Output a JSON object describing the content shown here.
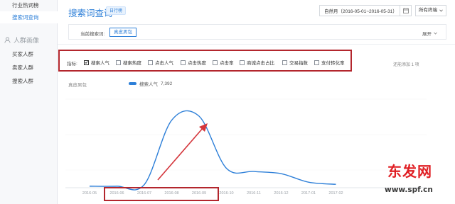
{
  "sidebar": {
    "items": [
      {
        "label": "行业热词榜",
        "active": false
      },
      {
        "label": "搜索词查询",
        "active": true
      }
    ],
    "section": {
      "label": "人群画像"
    },
    "section_items": [
      {
        "label": "买家人群"
      },
      {
        "label": "卖家人群"
      },
      {
        "label": "搜索人群"
      }
    ]
  },
  "header": {
    "title": "搜索词查询",
    "tag": "日行榜",
    "date_range": "自然月（2016-05-01~2016-05-31）",
    "terminal": "所有终端"
  },
  "search": {
    "current_label": "当前搜索词:",
    "current_term": "真皮男包",
    "collapse_label": "展开"
  },
  "metrics": {
    "label": "指标:",
    "options": [
      {
        "label": "搜索人气",
        "checked": true
      },
      {
        "label": "搜索热度",
        "checked": false
      },
      {
        "label": "点击人气",
        "checked": false
      },
      {
        "label": "点击热度",
        "checked": false
      },
      {
        "label": "点击率",
        "checked": false
      },
      {
        "label": "商城点击占比",
        "checked": false
      },
      {
        "label": "交易指数",
        "checked": false
      },
      {
        "label": "支付转化率",
        "checked": false
      }
    ],
    "reset_label": "还能添加 1 项"
  },
  "chart": {
    "title": "真皮男包",
    "legend_name": "搜索人气",
    "legend_value": "7,392",
    "color": "#2d7fd8",
    "highlight_color": "#b3262d"
  },
  "chart_data": {
    "type": "line",
    "x": [
      "2016-05",
      "2016-06",
      "2016-07",
      "2016-08",
      "2016-09",
      "2016-10",
      "2016-11",
      "2016-12",
      "2017-01",
      "2017-02"
    ],
    "series": [
      {
        "name": "搜索人气",
        "values": [
          0.3,
          0.3,
          0.9,
          25.0,
          26.5,
          7.0,
          5.8,
          5.0,
          1.8,
          1.0
        ]
      }
    ]
  },
  "watermark": {
    "brand": "东发网",
    "url": "www.spf.cn"
  }
}
